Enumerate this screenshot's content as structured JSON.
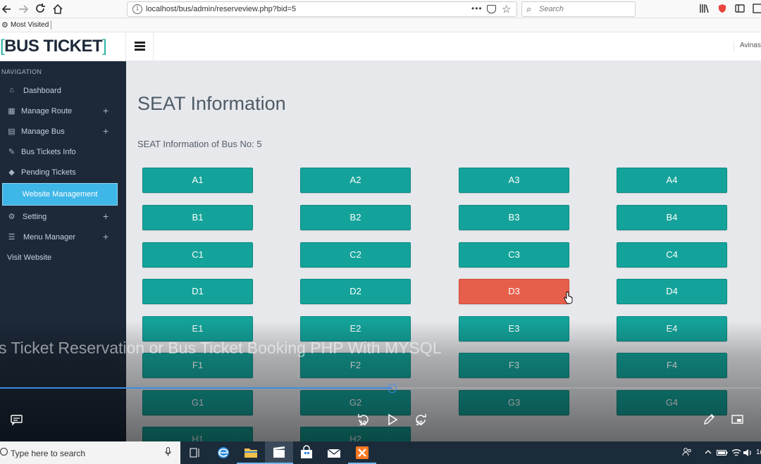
{
  "browser": {
    "url": "localhost/bus/admin/reserveview.php?bid=5",
    "search_placeholder": "Search",
    "bookmark_label": "Most Visited"
  },
  "header": {
    "logo_left_bracket": "[",
    "logo_text": "BUS TICKET",
    "logo_right_bracket": "]",
    "user_name": "Avinas"
  },
  "sidebar": {
    "heading": "NAVIGATION",
    "items": [
      {
        "label": "Dashboard",
        "icon": "home-icon",
        "has_plus": false
      },
      {
        "label": "Manage Route",
        "icon": "table-icon",
        "has_plus": true
      },
      {
        "label": "Manage Bus",
        "icon": "bar-chart-icon",
        "has_plus": true
      },
      {
        "label": "Bus Tickets Info",
        "icon": "edit-icon",
        "has_plus": false
      },
      {
        "label": "Pending Tickets",
        "icon": "tag-icon",
        "has_plus": false
      },
      {
        "label": "Website Management",
        "icon": "",
        "has_plus": false,
        "active": true
      },
      {
        "label": "Setting",
        "icon": "gear-icon",
        "has_plus": true
      },
      {
        "label": "Menu Manager",
        "icon": "list-icon",
        "has_plus": true
      },
      {
        "label": "Visit Website",
        "icon": "",
        "has_plus": false
      }
    ],
    "plus_symbol": "+"
  },
  "main": {
    "title": "SEAT Information",
    "subtitle": "SEAT Information of Bus No: 5",
    "seats": [
      [
        "A1",
        "A2",
        "A3",
        "A4"
      ],
      [
        "B1",
        "B2",
        "B3",
        "B4"
      ],
      [
        "C1",
        "C2",
        "C3",
        "C4"
      ],
      [
        "D1",
        "D2",
        "D3",
        "D4"
      ],
      [
        "E1",
        "E2",
        "E3",
        "E4"
      ],
      [
        "F1",
        "F2",
        "F3",
        "F4"
      ],
      [
        "G1",
        "G2",
        "G3",
        "G4"
      ],
      [
        "H1",
        "H2",
        "",
        ""
      ]
    ],
    "selected_seat": "D3",
    "colors": {
      "seat": "#14a39a",
      "selected": "#e65f4b",
      "sidebar": "#1d2939",
      "active_nav": "#3eb6e8"
    }
  },
  "video": {
    "title": "s Ticket Reservation or Bus Ticket Booking PHP With MYSQL",
    "progress_fraction": 0.516,
    "skip_back_label": "10",
    "skip_forward_label": "30"
  },
  "taskbar": {
    "search_placeholder": "Type here to search",
    "tray_clock": "1("
  }
}
